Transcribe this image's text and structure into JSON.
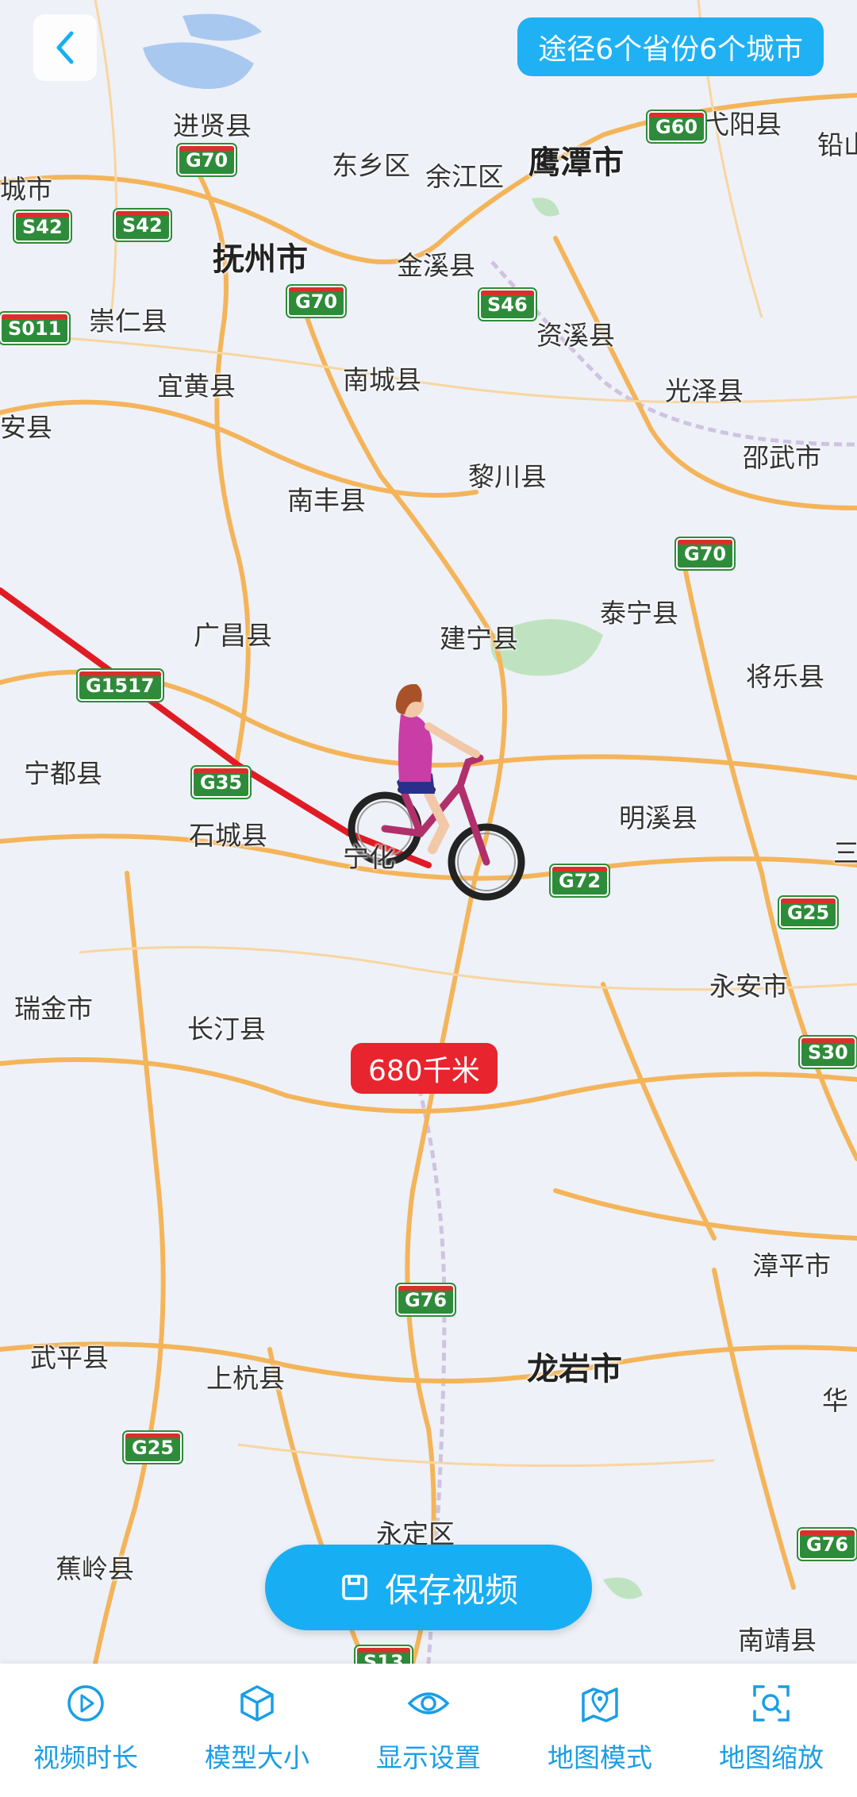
{
  "header": {
    "back_icon": "chevron-left-icon",
    "route_info": "途径6个省份6个城市"
  },
  "map": {
    "distance_label": "680千米",
    "places": [
      {
        "name": "进贤县",
        "major": false
      },
      {
        "name": "东乡区",
        "major": false
      },
      {
        "name": "余江区",
        "major": false
      },
      {
        "name": "鹰潭市",
        "major": true
      },
      {
        "name": "弋阳县",
        "major": false
      },
      {
        "name": "铅山",
        "major": false
      },
      {
        "name": "城市",
        "major": false
      },
      {
        "name": "抚州市",
        "major": true
      },
      {
        "name": "金溪县",
        "major": false
      },
      {
        "name": "崇仁县",
        "major": false
      },
      {
        "name": "资溪县",
        "major": false
      },
      {
        "name": "宜黄县",
        "major": false
      },
      {
        "name": "南城县",
        "major": false
      },
      {
        "name": "光泽县",
        "major": false
      },
      {
        "name": "安县",
        "major": false
      },
      {
        "name": "邵武市",
        "major": false
      },
      {
        "name": "黎川县",
        "major": false
      },
      {
        "name": "南丰县",
        "major": false
      },
      {
        "name": "泰宁县",
        "major": false
      },
      {
        "name": "广昌县",
        "major": false
      },
      {
        "name": "建宁县",
        "major": false
      },
      {
        "name": "将乐县",
        "major": false
      },
      {
        "name": "宁都县",
        "major": false
      },
      {
        "name": "明溪县",
        "major": false
      },
      {
        "name": "石城县",
        "major": false
      },
      {
        "name": "宁化",
        "major": false
      },
      {
        "name": "三",
        "major": false
      },
      {
        "name": "永安市",
        "major": false
      },
      {
        "name": "瑞金市",
        "major": false
      },
      {
        "name": "长汀县",
        "major": false
      },
      {
        "name": "漳平市",
        "major": false
      },
      {
        "name": "武平县",
        "major": false
      },
      {
        "name": "上杭县",
        "major": false
      },
      {
        "name": "龙岩市",
        "major": true
      },
      {
        "name": "华",
        "major": false
      },
      {
        "name": "永定区",
        "major": false
      },
      {
        "name": "蕉岭县",
        "major": false
      },
      {
        "name": "南靖县",
        "major": false
      }
    ],
    "shields": [
      "G60",
      "G70",
      "S42",
      "S42",
      "S011",
      "G70",
      "S46",
      "G70",
      "G1517",
      "G35",
      "G72",
      "G25",
      "S30",
      "G76",
      "G25",
      "G76",
      "S13"
    ],
    "colors": {
      "route": "#e01b24",
      "accent": "#18aef4",
      "badge": "#e8242e",
      "road": "#f4b45a"
    }
  },
  "save_button": {
    "icon": "save-icon",
    "label": "保存视频"
  },
  "bottom_nav": [
    {
      "icon": "play-circle-icon",
      "label": "视频时长"
    },
    {
      "icon": "cube-icon",
      "label": "模型大小"
    },
    {
      "icon": "eye-icon",
      "label": "显示设置"
    },
    {
      "icon": "map-pin-icon",
      "label": "地图模式"
    },
    {
      "icon": "zoom-focus-icon",
      "label": "地图缩放"
    }
  ]
}
